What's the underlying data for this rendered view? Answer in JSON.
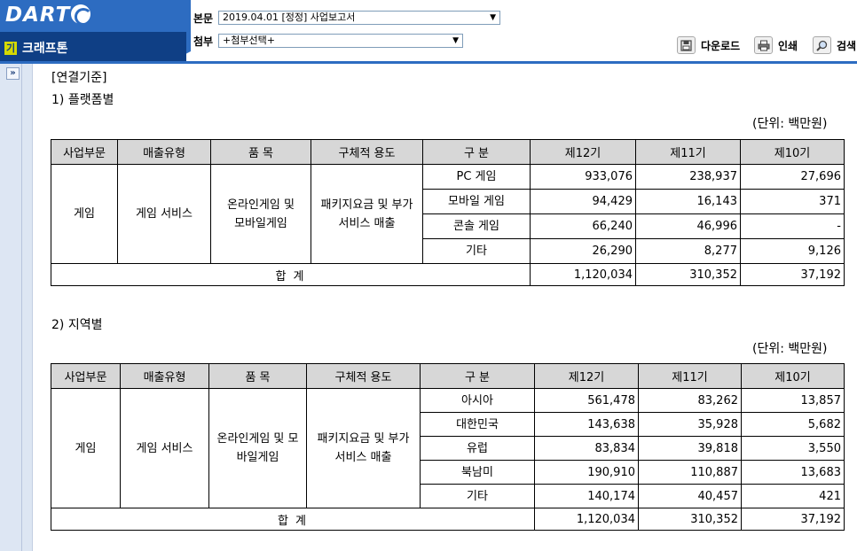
{
  "header": {
    "logo_text": "DART",
    "corp_badge": "기",
    "corp_name": "크래프톤",
    "main_doc_label": "본문",
    "main_doc_value": "2019.04.01  [정정] 사업보고서",
    "attach_label": "첨부",
    "attach_value": "+첨부선택+",
    "download_label": "다운로드",
    "print_label": "인쇄",
    "search_label": "검색"
  },
  "side": {
    "expand_glyph": "»"
  },
  "content": {
    "basis": "[연결기준]",
    "unit": "(단위: 백만원)",
    "sections": [
      {
        "title": "1) 플랫폼별",
        "headers": [
          "사업부문",
          "매출유형",
          "품 목",
          "구체적 용도",
          "구 분",
          "제12기",
          "제11기",
          "제10기"
        ],
        "segment": "게임",
        "sales_type": "게임 서비스",
        "item": "온라인게임 및 모바일게임",
        "usage": "패키지요금 및 부가서비스 매출",
        "rows": [
          {
            "label": "PC 게임",
            "v12": "933,076",
            "v11": "238,937",
            "v10": "27,696"
          },
          {
            "label": "모바일 게임",
            "v12": "94,429",
            "v11": "16,143",
            "v10": "371"
          },
          {
            "label": "콘솔 게임",
            "v12": "66,240",
            "v11": "46,996",
            "v10": "-"
          },
          {
            "label": "기타",
            "v12": "26,290",
            "v11": "8,277",
            "v10": "9,126"
          }
        ],
        "total": {
          "label": "합  계",
          "v12": "1,120,034",
          "v11": "310,352",
          "v10": "37,192"
        }
      },
      {
        "title": "2) 지역별",
        "headers": [
          "사업부문",
          "매출유형",
          "품 목",
          "구체적 용도",
          "구 분",
          "제12기",
          "제11기",
          "제10기"
        ],
        "segment": "게임",
        "sales_type": "게임 서비스",
        "item": "온라인게임 및 모바일게임",
        "usage": "패키지요금 및 부가서비스 매출",
        "rows": [
          {
            "label": "아시아",
            "v12": "561,478",
            "v11": "83,262",
            "v10": "13,857"
          },
          {
            "label": "대한민국",
            "v12": "143,638",
            "v11": "35,928",
            "v10": "5,682"
          },
          {
            "label": "유럽",
            "v12": "83,834",
            "v11": "39,818",
            "v10": "3,550"
          },
          {
            "label": "북남미",
            "v12": "190,910",
            "v11": "110,887",
            "v10": "13,683"
          },
          {
            "label": "기타",
            "v12": "140,174",
            "v11": "40,457",
            "v10": "421"
          }
        ],
        "total": {
          "label": "합  계",
          "v12": "1,120,034",
          "v11": "310,352",
          "v10": "37,192"
        }
      }
    ]
  }
}
